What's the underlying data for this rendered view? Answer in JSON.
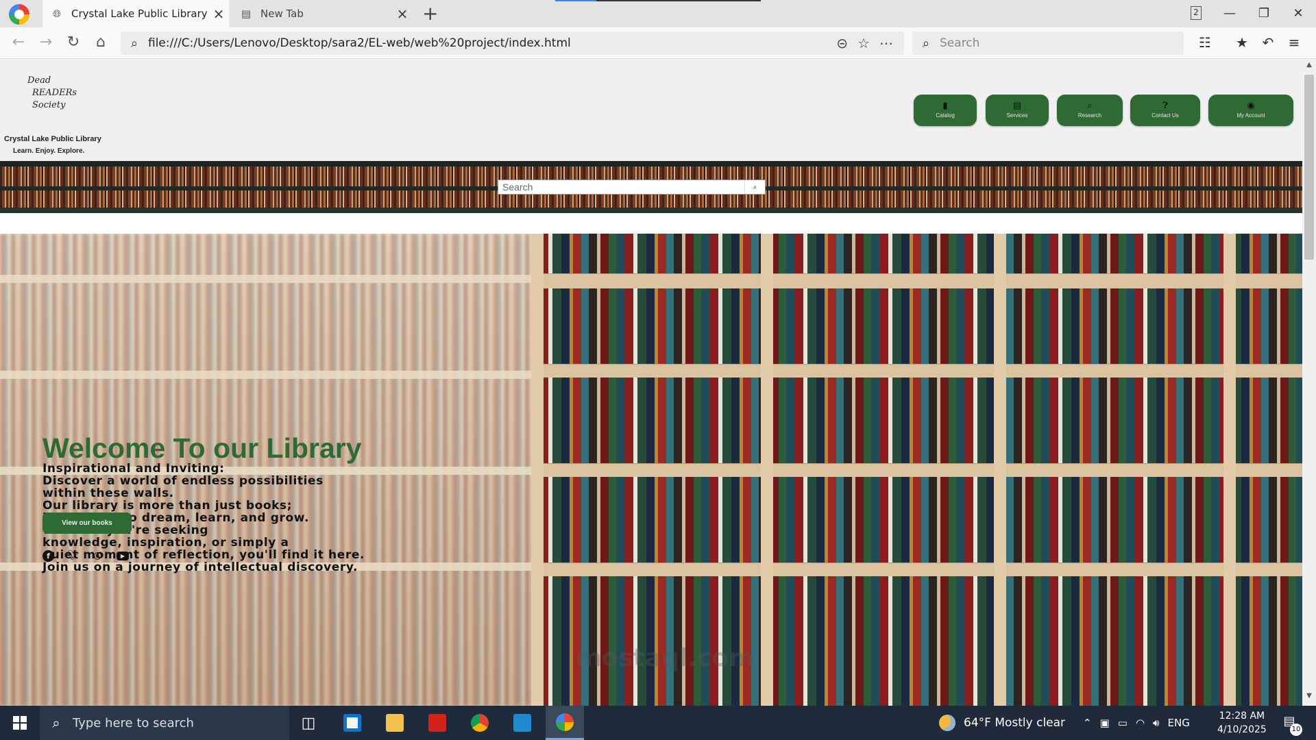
{
  "browser": {
    "tabs": [
      {
        "title": "Crystal Lake Public Library",
        "icon": "globe-icon",
        "active": true
      },
      {
        "title": "New Tab",
        "icon": "newtab-page-icon",
        "active": false
      }
    ],
    "window_count": "2",
    "url": "file:///C:/Users/Lenovo/Desktop/sara2/EL-web/web%20project/index.html",
    "search_placeholder": "Search"
  },
  "site": {
    "logo_lines": [
      "Dead",
      "READERs",
      "Society"
    ],
    "name": "Crystal Lake Public Library",
    "tagline": "Learn. Enjoy. Explore.",
    "nav": [
      {
        "label": "Catalog",
        "icon": "book-icon"
      },
      {
        "label": "Services",
        "icon": "newspaper-icon"
      },
      {
        "label": "Research",
        "icon": "search-icon"
      },
      {
        "label": "Contact Us",
        "icon": "question-icon"
      },
      {
        "label": "My Account",
        "icon": "user-circle-icon"
      }
    ],
    "banner_search_placeholder": "Search",
    "hero": {
      "title": "Welcome To our Library",
      "lines": [
        "Inspirational and Inviting:",
        "Discover a world of endless possibilities",
        "within these walls.",
        "Our library is more than just books;",
        "it's a place to dream, learn, and grow.",
        "Whether you're seeking",
        "knowledge, inspiration, or simply a",
        "quiet moment of reflection, you'll find it here.",
        "Join us on a journey of intellectual discovery."
      ],
      "button_label": "View our books"
    },
    "socials": [
      "facebook-icon",
      "twitter-icon",
      "instagram-icon",
      "youtube-icon"
    ],
    "colors": {
      "brand_green": "#2f6a35"
    }
  },
  "watermark": "mostaql.com",
  "taskbar": {
    "search_placeholder": "Type here to search",
    "weather": "64°F  Mostly clear",
    "language": "ENG",
    "time": "12:28 AM",
    "date": "4/10/2025",
    "notification_count": "10"
  }
}
